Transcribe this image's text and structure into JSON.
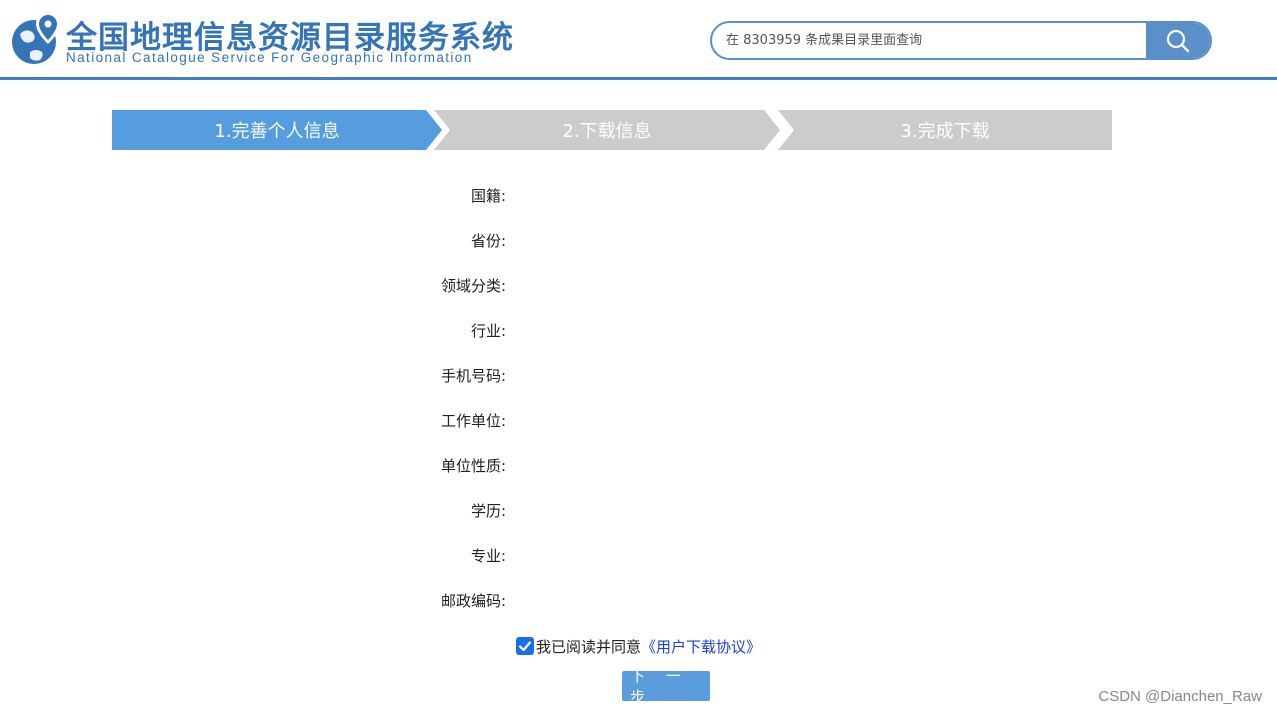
{
  "header": {
    "title": "全国地理信息资源目录服务系统",
    "subtitle": "National Catalogue Service For Geographic Information",
    "logo_icon": "globe-pin-icon",
    "search": {
      "placeholder": "在 8303959 条成果目录里面查询",
      "button_icon": "search-icon"
    }
  },
  "steps": [
    {
      "label": "1.完善个人信息",
      "active": true
    },
    {
      "label": "2.下载信息",
      "active": false
    },
    {
      "label": "3.完成下载",
      "active": false
    }
  ],
  "form": {
    "fields": [
      {
        "label": "国籍:"
      },
      {
        "label": "省份:"
      },
      {
        "label": "领域分类:"
      },
      {
        "label": "行业:"
      },
      {
        "label": "手机号码:"
      },
      {
        "label": "工作单位:"
      },
      {
        "label": "单位性质:"
      },
      {
        "label": "学历:"
      },
      {
        "label": "专业:"
      },
      {
        "label": "邮政编码:"
      }
    ],
    "agree": {
      "checked": true,
      "text": "我已阅读并同意",
      "link": "《用户下载协议》"
    },
    "next_button": "下 一 步"
  },
  "watermark": "CSDN @Dianchen_Raw",
  "colors": {
    "brand_blue": "#3474b7",
    "active_step": "#569ddf",
    "inactive_step": "#cccccc",
    "button_blue": "#5b9ddc",
    "link_blue": "#1b3ee0"
  }
}
